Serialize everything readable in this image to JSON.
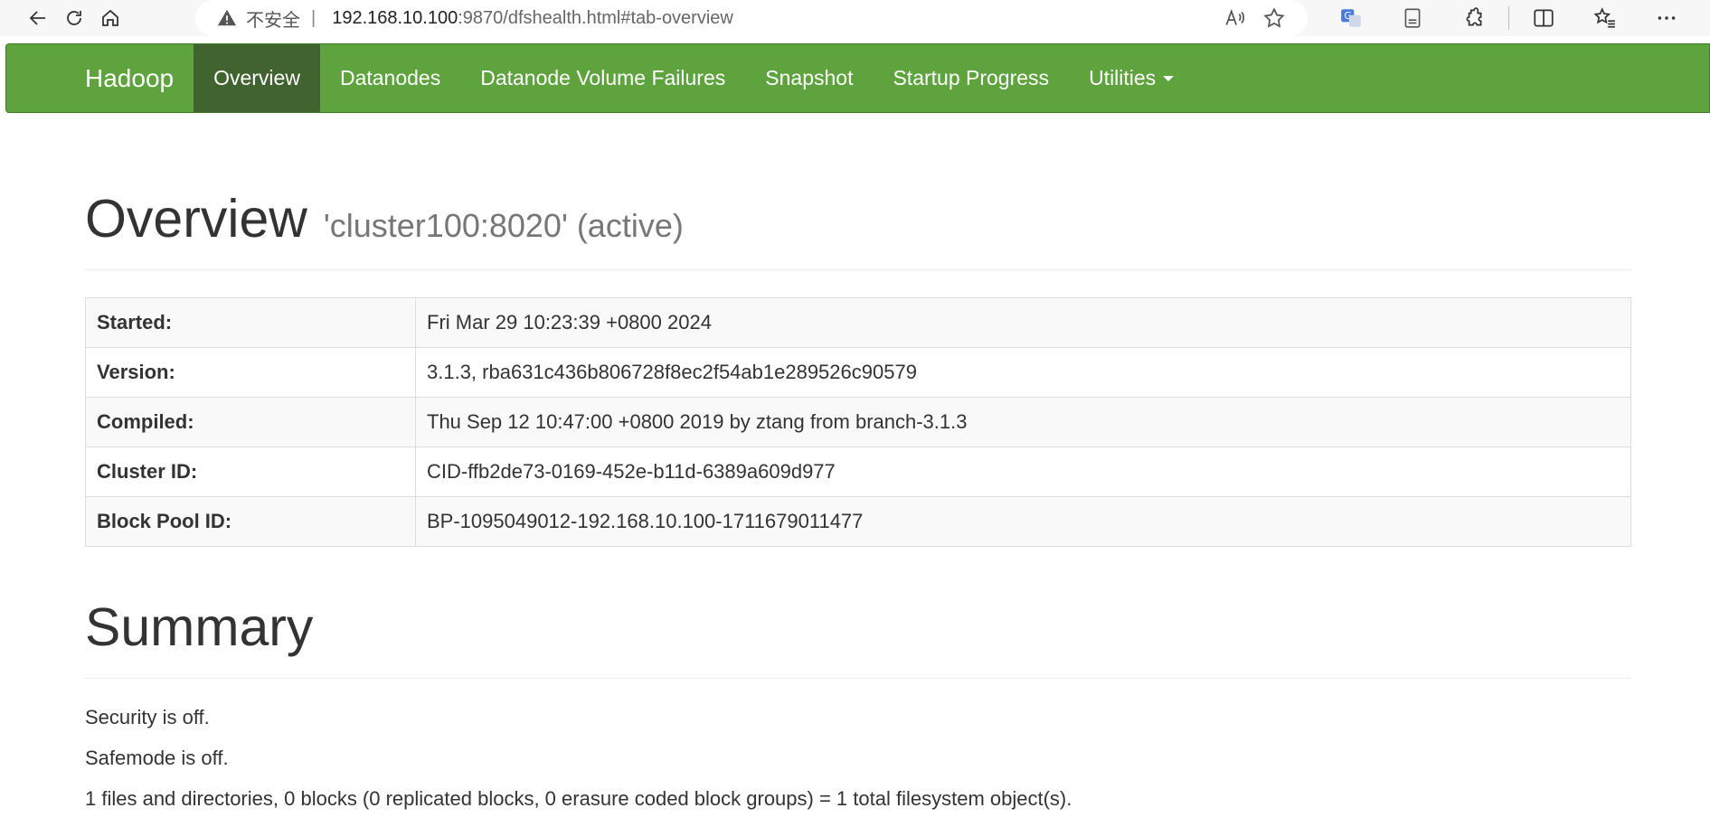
{
  "browser": {
    "security_label": "不安全",
    "separator": "|",
    "url_host": "192.168.10.100",
    "url_rest": ":9870/dfshealth.html#tab-overview"
  },
  "navbar": {
    "brand": "Hadoop",
    "items": [
      {
        "label": "Overview",
        "active": true
      },
      {
        "label": "Datanodes",
        "active": false
      },
      {
        "label": "Datanode Volume Failures",
        "active": false
      },
      {
        "label": "Snapshot",
        "active": false
      },
      {
        "label": "Startup Progress",
        "active": false
      },
      {
        "label": "Utilities",
        "active": false
      }
    ],
    "color": "#5fa33e",
    "active_color": "#41632f"
  },
  "overview": {
    "title": "Overview",
    "subtitle": "'cluster100:8020' (active)",
    "rows": [
      {
        "key": "Started:",
        "value": "Fri Mar 29 10:23:39 +0800 2024"
      },
      {
        "key": "Version:",
        "value": "3.1.3, rba631c436b806728f8ec2f54ab1e289526c90579"
      },
      {
        "key": "Compiled:",
        "value": "Thu Sep 12 10:47:00 +0800 2019 by ztang from branch-3.1.3"
      },
      {
        "key": "Cluster ID:",
        "value": "CID-ffb2de73-0169-452e-b11d-6389a609d977"
      },
      {
        "key": "Block Pool ID:",
        "value": "BP-1095049012-192.168.10.100-1711679011477"
      }
    ]
  },
  "summary": {
    "title": "Summary",
    "lines": [
      "Security is off.",
      "Safemode is off.",
      "1 files and directories, 0 blocks (0 replicated blocks, 0 erasure coded block groups) = 1 total filesystem object(s)."
    ]
  }
}
